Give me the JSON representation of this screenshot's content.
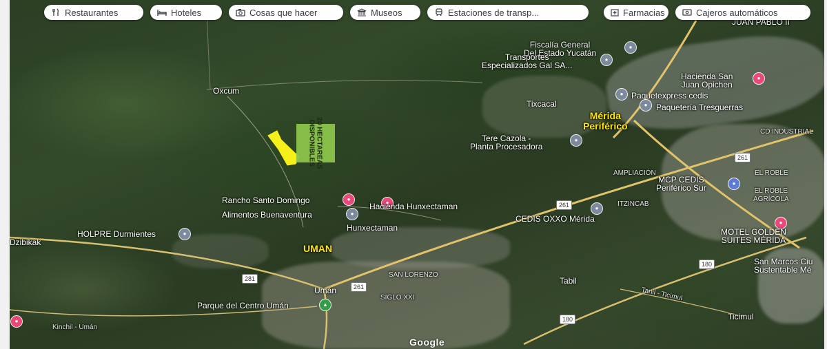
{
  "chips": [
    {
      "label": "Restaurantes",
      "icon": "restaurant-icon"
    },
    {
      "label": "Hoteles",
      "icon": "hotel-icon"
    },
    {
      "label": "Cosas que hacer",
      "icon": "camera-icon"
    },
    {
      "label": "Museos",
      "icon": "museum-icon"
    },
    {
      "label": "Estaciones de transp...",
      "icon": "transit-icon"
    },
    {
      "label": "Farmacias",
      "icon": "pharmacy-icon"
    },
    {
      "label": "Cajeros automáticos",
      "icon": "atm-icon"
    }
  ],
  "places": {
    "juan_pablo": "JUAN PABLO II",
    "fiscalia": "Fiscalía General\nDel Estado Yucatán",
    "transportes": "Transportes\nEspecializados Gal SA...",
    "hacienda_san_juan": "Hacienda San\nJuan Opichen",
    "paquetexpress": "Paquetexpress cedis",
    "tixcacal": "Tixcacal",
    "tresguerras": "Paquetería Tresguerras",
    "oxcum": "Oxcum",
    "tere_cazola": "Tere Cazola -\nPlanta Procesadora",
    "industrial": "CD INDUSTRIAL",
    "ampliacion": "AMPLIACIÓN",
    "mcp_cedis": "MCP CEDIS\nPeriférico Sur",
    "el_roble": "EL ROBLE",
    "el_roble_agricola": "EL ROBLE\nAGRÍCOLA",
    "rancho": "Rancho Santo Domingo",
    "hacienda_hunx": "Hacienda Hunxectaman",
    "alimentos": "Alimentos Buenaventura",
    "hunxectaman": "Hunxectaman",
    "itzincab": "ITZINCAB",
    "cedis_oxxo": "CEDIS OXXO Mérida",
    "motel": "MOTEL GOLDEN\nSUITES MÉRIDA",
    "holpre": "HOLPRE Durmientes",
    "dzibikak": "Dzibikak",
    "san_marcos": "San Marcos Ciu\nSustentable Mé",
    "san_lorenzo": "SAN LORENZO",
    "uman_town": "Umán",
    "tabil": "Tabil",
    "parque": "Parque del Centro Umán",
    "siglo": "SIGLO XXI",
    "tanil": "Tanil - Ticimul",
    "ticimul": "Ticimul",
    "kinchil": "Kinchil - Umán"
  },
  "annotations": {
    "merida": "Mérida\nPeriférico",
    "uman": "UMAN",
    "sign": "20 HECTAREAS\nDISPONIBLES"
  },
  "shields": {
    "r261_top": "261",
    "r261_mid": "261",
    "r261_uman": "261",
    "r281": "281",
    "r180_a": "180",
    "r180_b": "180"
  },
  "attribution": "Google"
}
